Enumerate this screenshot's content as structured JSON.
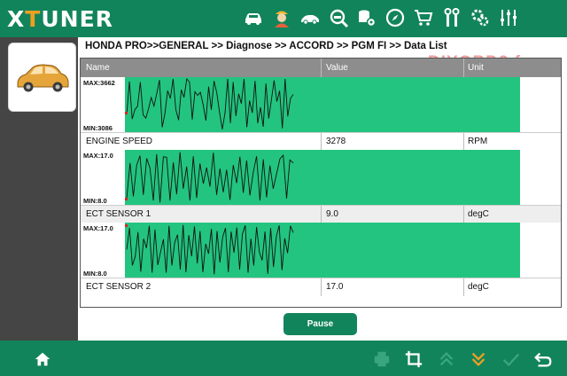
{
  "app": {
    "logo_left": "X",
    "logo_accent": "T",
    "logo_right": "UNER"
  },
  "top_icons": [
    "car-icon",
    "mechanic-icon",
    "sport-car-icon",
    "car-search-icon",
    "database-gear-icon",
    "compass-icon",
    "cart-icon",
    "tools-icon",
    "settings-icon",
    "sliders-icon"
  ],
  "breadcrumb": "HONDA PRO>>GENERAL >> Diagnose >> ACCORD >> PGM FI >> Data List",
  "watermark": "DIYOBD2.fr",
  "table": {
    "col_name": "Name",
    "col_value": "Value",
    "col_unit": "Unit"
  },
  "rows": [
    {
      "max_label": "MAX:3662",
      "min_label": "MIN:3086",
      "name": "ENGINE SPEED",
      "value": "3278",
      "unit": "RPM"
    },
    {
      "max_label": "MAX:17.0",
      "min_label": "MIN:8.0",
      "name": "ECT SENSOR 1",
      "value": "9.0",
      "unit": "degC"
    },
    {
      "max_label": "MAX:17.0",
      "min_label": "MIN:8.0",
      "name": "ECT SENSOR 2",
      "value": "17.0",
      "unit": "degC"
    }
  ],
  "graph_traces": [
    [
      0.31,
      0.95,
      0.22,
      0.4,
      0.47,
      0.94,
      0.3,
      0.24,
      0.42,
      0.64,
      0.47,
      0.71,
      0.98,
      0.06,
      0.32,
      0.77,
      0.62,
      1.0,
      0.4,
      0.2,
      0.79,
      0.64,
      1.0,
      0.94,
      0.21,
      0.75,
      0.68,
      0.74,
      0.5,
      0.19,
      0.85,
      0.4,
      0.96,
      0.73,
      0.35,
      0.02,
      0.34,
      1.0,
      0.14,
      0.94,
      0.28,
      0.71,
      0.52,
      1.0,
      0.06,
      0.58,
      0.34,
      0.96,
      0.14,
      0.45,
      0.07,
      0.91,
      0.23,
      0.59,
      0.97,
      0.56,
      0.77,
      0.04,
      1.0,
      0.27,
      0.62,
      0.7
    ],
    [
      0.09,
      0.78,
      0.13,
      0.74,
      0.92,
      0.16,
      0.87,
      0.68,
      0.05,
      0.95,
      0.01,
      0.9,
      0.89,
      0.05,
      0.79,
      0.17,
      0.99,
      0.28,
      0.71,
      0.05,
      0.91,
      0.1,
      0.77,
      0.38,
      0.69,
      0.32,
      0.98,
      0.16,
      0.67,
      0.21,
      0.65,
      0.06,
      0.74,
      0.39,
      0.9,
      0.2,
      0.83,
      0.15,
      0.6,
      0.91,
      0.05,
      0.85,
      0.11,
      0.73,
      0.28,
      0.57,
      0.86,
      0.93,
      0.09,
      0.84,
      0.78
    ],
    [
      0.51,
      0.93,
      0.2,
      0.37,
      0.85,
      0.08,
      0.72,
      0.54,
      0.97,
      0.06,
      0.9,
      0.21,
      0.46,
      0.71,
      0.06,
      0.97,
      0.2,
      0.65,
      0.8,
      0.12,
      0.99,
      0.07,
      0.79,
      0.38,
      0.96,
      0.24,
      0.87,
      0.07,
      0.62,
      0.43,
      0.91,
      0.03,
      0.87,
      0.26,
      0.75,
      0.93,
      0.07,
      0.86,
      0.45,
      0.94,
      0.12,
      0.81,
      0.98,
      0.06,
      0.72,
      0.2,
      0.95,
      0.46,
      0.3,
      0.86,
      0.04,
      0.93,
      0.17,
      0.76,
      0.98,
      0.11,
      0.73,
      0.44,
      0.97,
      0.84
    ]
  ],
  "pause_label": "Pause",
  "bottom_icons": [
    "home-icon",
    "print-icon",
    "crop-icon",
    "page-up-icon",
    "page-down-icon",
    "confirm-icon",
    "back-icon"
  ],
  "colors": {
    "brand_green": "#12845c",
    "graph_green": "#23c47f",
    "logo_accent": "#f0a020",
    "sidebar": "#454545",
    "header": "#8d8d8d"
  }
}
